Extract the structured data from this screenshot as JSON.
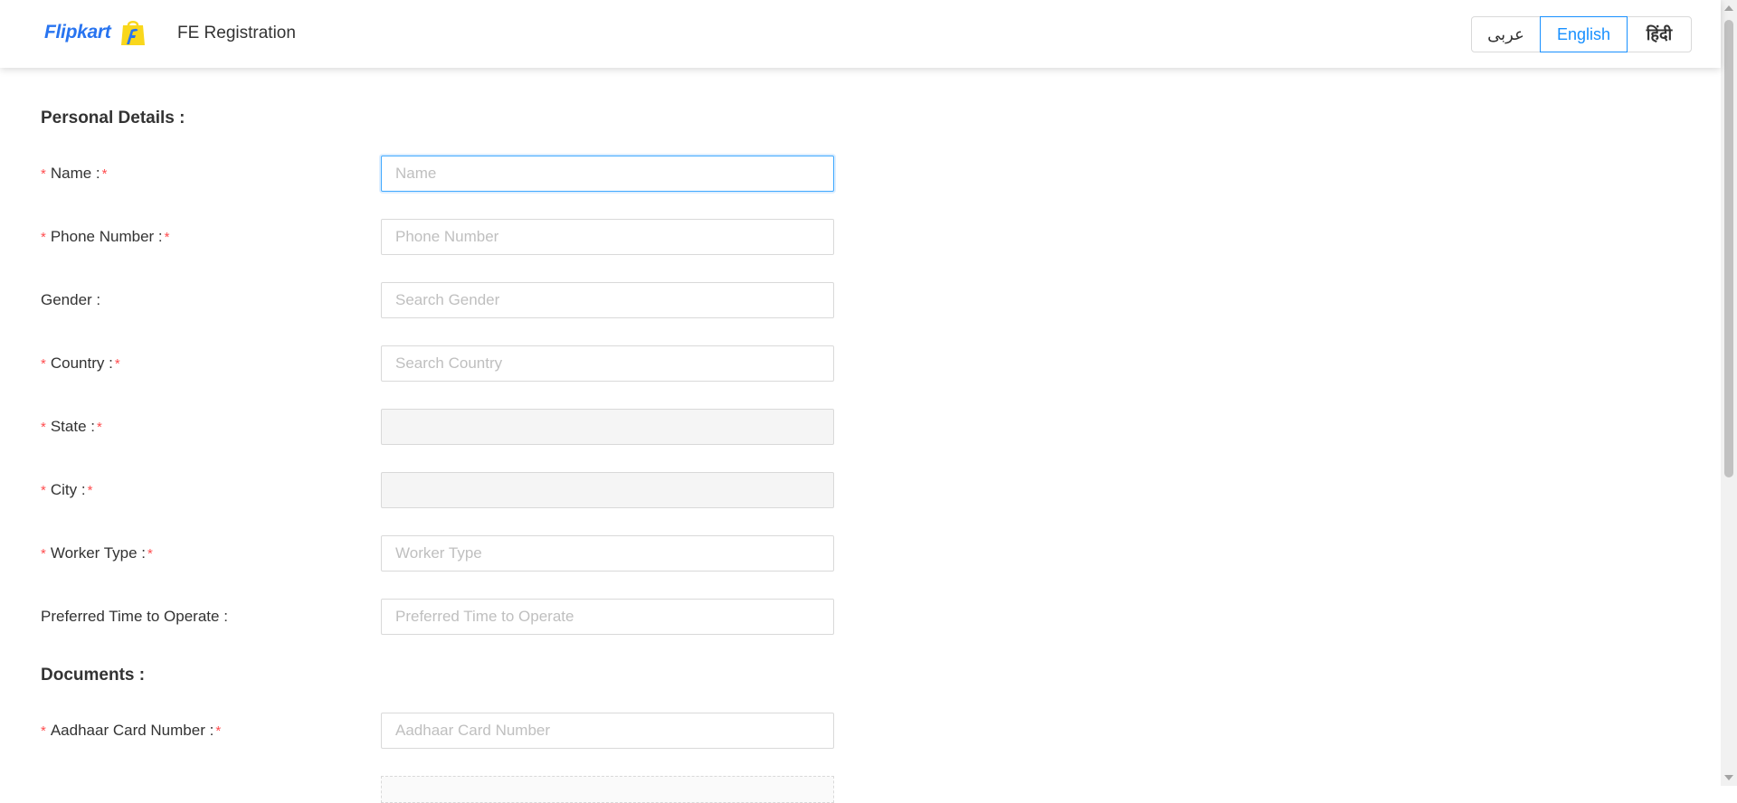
{
  "header": {
    "logo_text": "Flipkart",
    "title": "FE Registration",
    "languages": [
      {
        "label": "عربى",
        "active": false
      },
      {
        "label": "English",
        "active": true
      },
      {
        "label": "हिंदी",
        "active": false
      }
    ]
  },
  "colors": {
    "brand_blue": "#2874f0",
    "brand_yellow": "#f9d71c",
    "accent": "#1890ff",
    "required": "#ff4d4f"
  },
  "sections": {
    "personal": "Personal Details :",
    "documents": "Documents :"
  },
  "fields": {
    "name": {
      "label": "Name :",
      "placeholder": "Name",
      "value": "",
      "required": true
    },
    "phone": {
      "label": "Phone Number :",
      "placeholder": "Phone Number",
      "value": "",
      "required": true
    },
    "gender": {
      "label": "Gender :",
      "placeholder": "Search Gender",
      "value": "",
      "required": false
    },
    "country": {
      "label": "Country :",
      "placeholder": "Search Country",
      "value": "",
      "required": true
    },
    "state": {
      "label": "State :",
      "placeholder": "",
      "value": "",
      "required": true
    },
    "city": {
      "label": "City :",
      "placeholder": "",
      "value": "",
      "required": true
    },
    "worker_type": {
      "label": "Worker Type :",
      "placeholder": "Worker Type",
      "value": "",
      "required": true
    },
    "preferred_time": {
      "label": "Preferred Time to Operate :",
      "placeholder": "Preferred Time to Operate",
      "value": "",
      "required": false
    },
    "aadhaar": {
      "label": "Aadhaar Card Number :",
      "placeholder": "Aadhaar Card Number",
      "value": "",
      "required": true
    }
  },
  "marks": {
    "required": "*"
  }
}
